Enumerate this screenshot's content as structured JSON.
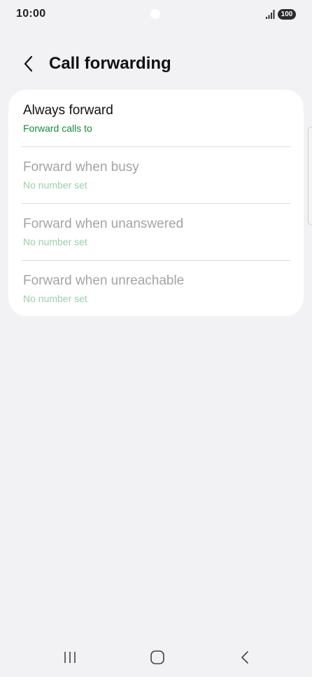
{
  "status_bar": {
    "time": "10:00",
    "battery": "100",
    "icons": [
      "signal-icon",
      "battery-icon"
    ]
  },
  "header": {
    "title": "Call forwarding",
    "back_icon": "chevron-left-icon"
  },
  "options": [
    {
      "title": "Always forward",
      "subtitle": "Forward calls to",
      "enabled": true
    },
    {
      "title": "Forward when busy",
      "subtitle": "No number set",
      "enabled": false
    },
    {
      "title": "Forward when unanswered",
      "subtitle": "No number set",
      "enabled": false
    },
    {
      "title": "Forward when unreachable",
      "subtitle": "No number set",
      "enabled": false
    }
  ],
  "nav_bar": {
    "icons": [
      "recents-icon",
      "home-icon",
      "back-icon"
    ]
  },
  "colors": {
    "background": "#f2f2f4",
    "card": "#ffffff",
    "accent_green": "#1a8a3a",
    "disabled_text": "#a4a4a4",
    "disabled_subtitle": "#9bcfaa"
  }
}
